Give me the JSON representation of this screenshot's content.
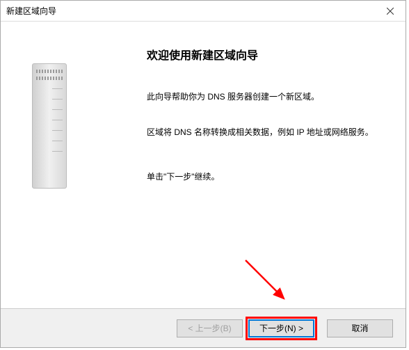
{
  "titlebar": {
    "title": "新建区域向导"
  },
  "content": {
    "heading": "欢迎使用新建区域向导",
    "line1": "此向导帮助你为 DNS 服务器创建一个新区域。",
    "line2": "区域将 DNS 名称转换成相关数据，例如 IP 地址或网络服务。",
    "line3": "单击\"下一步\"继续。"
  },
  "footer": {
    "back": "< 上一步(B)",
    "next": "下一步(N) >",
    "cancel": "取消"
  }
}
